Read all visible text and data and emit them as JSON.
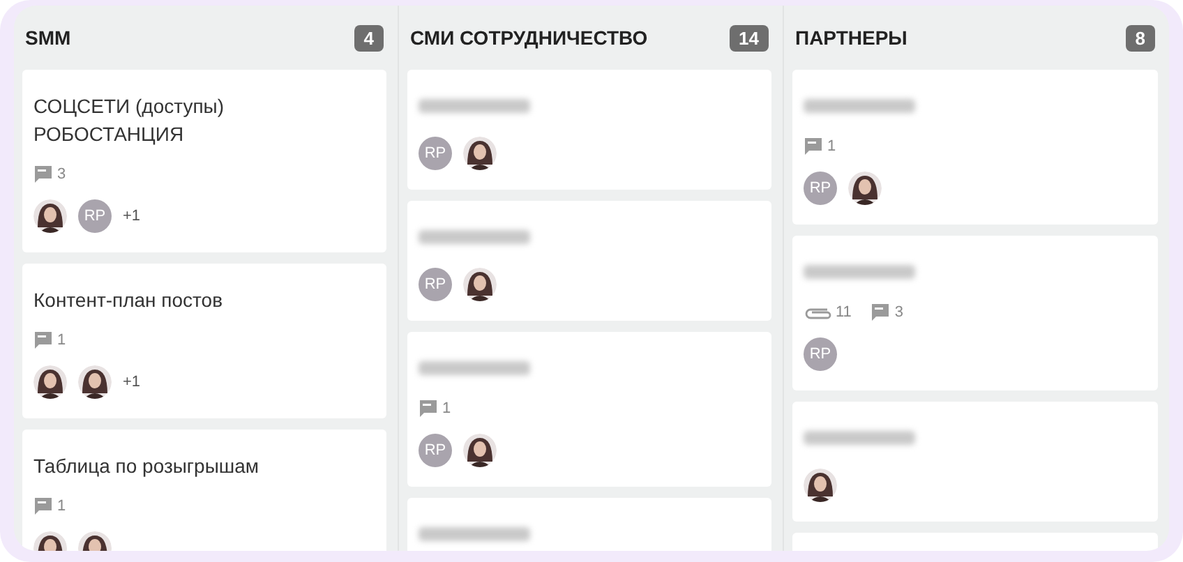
{
  "columns": [
    {
      "title": "SMM",
      "count": "4",
      "cards": [
        {
          "title": "СОЦСЕТИ (доступы) РОБОСТАНЦИЯ",
          "blurred": false,
          "badges": [
            {
              "kind": "comments",
              "count": "3"
            }
          ],
          "members": [
            {
              "kind": "photo"
            },
            {
              "kind": "initials",
              "initials": "RP"
            }
          ],
          "extra": "+1"
        },
        {
          "title": "Контент-план постов",
          "blurred": false,
          "badges": [
            {
              "kind": "comments",
              "count": "1"
            }
          ],
          "members": [
            {
              "kind": "photo"
            },
            {
              "kind": "photo"
            }
          ],
          "extra": "+1"
        },
        {
          "title": "Таблица по розыгрышам",
          "blurred": false,
          "badges": [
            {
              "kind": "comments",
              "count": "1"
            }
          ],
          "members": [
            {
              "kind": "photo"
            },
            {
              "kind": "photo"
            }
          ]
        }
      ]
    },
    {
      "title": "СМИ СОТРУДНИЧЕСТВО",
      "count": "14",
      "cards": [
        {
          "blurred": true,
          "members": [
            {
              "kind": "initials",
              "initials": "RP"
            },
            {
              "kind": "photo"
            }
          ]
        },
        {
          "blurred": true,
          "members": [
            {
              "kind": "initials",
              "initials": "RP"
            },
            {
              "kind": "photo"
            }
          ]
        },
        {
          "blurred": true,
          "badges": [
            {
              "kind": "comments",
              "count": "1"
            }
          ],
          "members": [
            {
              "kind": "initials",
              "initials": "RP"
            },
            {
              "kind": "photo"
            }
          ]
        },
        {
          "blurred": true
        }
      ]
    },
    {
      "title": "ПАРТНЕРЫ",
      "count": "8",
      "cards": [
        {
          "blurred": true,
          "badges": [
            {
              "kind": "comments",
              "count": "1"
            }
          ],
          "members": [
            {
              "kind": "initials",
              "initials": "RP"
            },
            {
              "kind": "photo"
            }
          ]
        },
        {
          "blurred": true,
          "badges": [
            {
              "kind": "attachments",
              "count": "11"
            },
            {
              "kind": "comments",
              "count": "3"
            }
          ],
          "members": [
            {
              "kind": "initials",
              "initials": "RP"
            }
          ]
        },
        {
          "blurred": true,
          "members": [
            {
              "kind": "photo"
            }
          ]
        }
      ],
      "card_below": true
    }
  ]
}
